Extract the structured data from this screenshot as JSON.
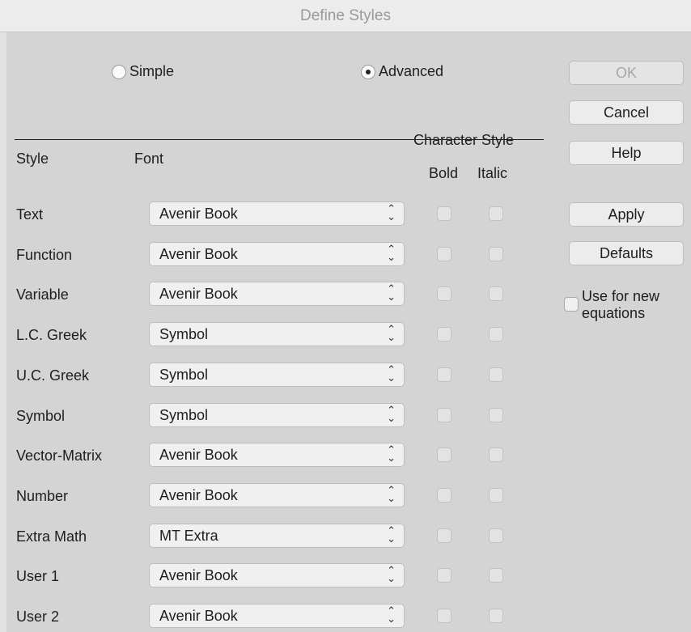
{
  "window": {
    "title": "Define Styles"
  },
  "mode": {
    "simple_label": "Simple",
    "advanced_label": "Advanced",
    "selected": "Advanced"
  },
  "table": {
    "headers": {
      "style": "Style",
      "font": "Font",
      "character_style": "Character Style",
      "bold": "Bold",
      "italic": "Italic"
    },
    "rows": [
      {
        "style": "Text",
        "font": "Avenir Book",
        "bold": false,
        "italic": false
      },
      {
        "style": "Function",
        "font": "Avenir Book",
        "bold": false,
        "italic": false
      },
      {
        "style": "Variable",
        "font": "Avenir Book",
        "bold": false,
        "italic": false
      },
      {
        "style": "L.C. Greek",
        "font": "Symbol",
        "bold": false,
        "italic": false
      },
      {
        "style": "U.C. Greek",
        "font": "Symbol",
        "bold": false,
        "italic": false
      },
      {
        "style": "Symbol",
        "font": "Symbol",
        "bold": false,
        "italic": false
      },
      {
        "style": "Vector-Matrix",
        "font": "Avenir Book",
        "bold": false,
        "italic": false
      },
      {
        "style": "Number",
        "font": "Avenir Book",
        "bold": false,
        "italic": false
      },
      {
        "style": "Extra Math",
        "font": "MT Extra",
        "bold": false,
        "italic": false
      },
      {
        "style": "User 1",
        "font": "Avenir Book",
        "bold": false,
        "italic": false
      },
      {
        "style": "User 2",
        "font": "Avenir Book",
        "bold": false,
        "italic": false
      }
    ]
  },
  "buttons": {
    "ok": "OK",
    "cancel": "Cancel",
    "help": "Help",
    "apply": "Apply",
    "defaults": "Defaults"
  },
  "use_for_new": {
    "line1": "Use for new",
    "line2": "equations",
    "checked": false
  },
  "colors": {
    "dialog_bg": "#d4d4d4",
    "disabled_text": "#a6a6a6"
  }
}
